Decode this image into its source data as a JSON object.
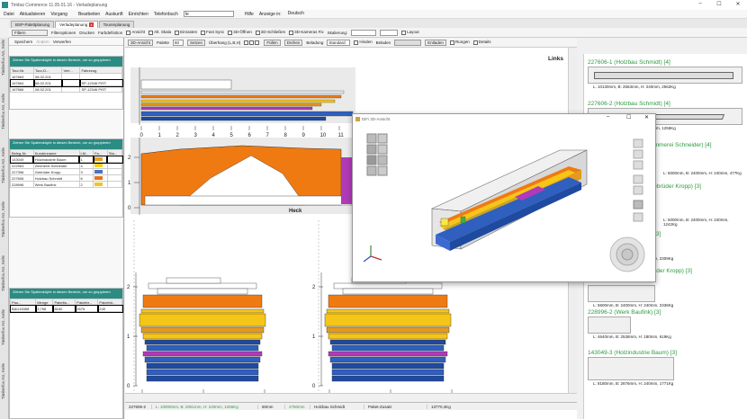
{
  "window": {
    "title": "Timbai Commerce 11.05.01.16 - Verladeplanung",
    "min": "–",
    "max": "☐",
    "close": "✕"
  },
  "menu": {
    "items": [
      "Datei",
      "Aktualisieren",
      "Vorgang",
      "Bearbeiten",
      "Auskunft",
      "Einrichten",
      "Telefonbuch"
    ],
    "phonebook_value": "le",
    "help": "Hilfe",
    "display_label": "Anzeige in:",
    "display_value": "Deutsch"
  },
  "tabs": [
    {
      "label": "BSP-Palettplanung"
    },
    {
      "label": "Verladeplanung",
      "close": "x"
    },
    {
      "label": "Tourenplanung"
    }
  ],
  "toolbar": {
    "filter": "Filtern",
    "filteroptions": "Filteroptionen",
    "print": "Drucken",
    "colordef": "Farbdefinition",
    "checks": [
      "Ansicht",
      "Alt. Skala",
      "Einrasten",
      "Fast Sync",
      "3D-Öffnen",
      "3D-Schließen",
      "3D-Kameras Fix"
    ],
    "scale_label": "Skalierung:",
    "layout": "Layout"
  },
  "side_labels": [
    "Timberfox AG, Kelle",
    "Timberfox AG, Kelle",
    "Timberfox AG, Kelle",
    "Timberfox AG, Kelle",
    "Timberfox AG, Kelle",
    "Timberfox AG, Kelle",
    "Timberfox AG, Kelle"
  ],
  "left": {
    "subtabs": [
      "Speichern",
      "Ändern",
      "Verwerfen"
    ],
    "group_hint": "Ziehen Sie Spaltenköpfe in diesen Bereich, um zu gruppieren",
    "tours": {
      "headers": [
        "Tour-Nr.",
        "Tour-D...",
        "Verl...",
        "Fahrzeug"
      ],
      "rows": [
        [
          "167663",
          "08.02.201",
          "",
          ""
        ],
        [
          "167664",
          "08.02.201",
          "",
          "SP-12346 PIST"
        ],
        [
          "167666",
          "08.02.201",
          "",
          "SP-12346 PIST"
        ]
      ]
    },
    "orders": {
      "headers": [
        "Beleg-Nr.",
        "Kundenname",
        "LM...",
        "Fa...",
        "Sta..."
      ],
      "rows": [
        {
          "cells": [
            "143049",
            "Holzindustrie Baum",
            "1"
          ],
          "color": "#e8a020"
        },
        {
          "cells": [
            "222963",
            "Zimmerei Schneider",
            "4"
          ],
          "color": "#f5d020"
        },
        {
          "cells": [
            "227396",
            "Gebrüder Kropp",
            "3"
          ],
          "color": "#4a72c0"
        },
        {
          "cells": [
            "227606",
            "Holzbau Schmidt",
            "6"
          ],
          "color": "#e8701a"
        },
        {
          "cells": [
            "228996",
            "Werk Baufink",
            "2"
          ],
          "color": "#f5c518"
        }
      ]
    },
    "positions": {
      "headers": [
        "Pau...",
        "Menge",
        "Paketla...",
        "Paketbr...",
        "Pakethö..."
      ],
      "rows": [
        [
          "BAU16368",
          "3,768",
          "8160",
          "2676",
          "240"
        ]
      ]
    }
  },
  "main": {
    "view3d": "3D-Ansicht",
    "pallet_label": "Palette",
    "pallet_value": "60",
    "set_label": "Setzen",
    "overhang_label": "Überhang (L,B,H)",
    "fill": "Füllen",
    "rotate": "Drehen",
    "loading_label": "Beladung",
    "loading_value": "Standard",
    "hide": "Hinden",
    "load": "Beladen",
    "unload": "Entladen",
    "rungen": "Rungen",
    "details": "Details",
    "links": "Links",
    "heck": "Heck",
    "axis_top": [
      "0",
      "1",
      "2",
      "3",
      "4",
      "5",
      "6",
      "7",
      "8",
      "9",
      "10",
      "11"
    ],
    "axis_bottom": [
      "0",
      "1",
      "2"
    ],
    "axis_y": [
      "0",
      "1",
      "2"
    ],
    "status": [
      "227606-2",
      "L: 10000mm, B: 2051mm, H: 240mm, 1255Kg",
      "60mm",
      "2760mm",
      "Holzbau Schmidt",
      "Paket-Zusatz",
      "13770,4Kg"
    ]
  },
  "right": {
    "items": [
      {
        "title": "227606-1 (Holzbau Schmidt) [4]",
        "dims": "L: 10130mm, B: 2563mm, H: 240mm, 2562Kg"
      },
      {
        "title": "227606-2 (Holzbau Schmidt) [4]",
        "dims": "L: 10000mm, B: 2051mm, H: 240mm, 1255Kg"
      },
      {
        "title": "(Zimmerei Schneider) [4]",
        "dims": "L: 5000mm, B: 2400mm, H: 240mm, 477Kg"
      },
      {
        "title": "(Gebrüder Kropp) [3]",
        "dims": "L: 5000mm, B: 2400mm, H: 240mm, 1242Kg"
      },
      {
        "title": "228996-1 (Werk Baufink) [3]",
        "dims": "L: 5000mm, B: 2400mm, H: 240mm, 2309Kg"
      },
      {
        "title": "(Gebrüder Kropp) [3]",
        "dims": "L: 5600mm, B: 2400mm, H: 240mm, 2336Kg"
      },
      {
        "title": "228996-2 (Werk Baufink) [3]",
        "dims": "L: 4640mm, B: 2538mm, H: 180mm, 619Kg"
      },
      {
        "title": "143049-3 (Holzindustrie Baum) [3]",
        "dims": "L: 8180mm, B: 2676mm, H: 240mm, 1771Kg"
      }
    ]
  },
  "dialog": {
    "title": "DiFi 3D-Ansicht"
  }
}
